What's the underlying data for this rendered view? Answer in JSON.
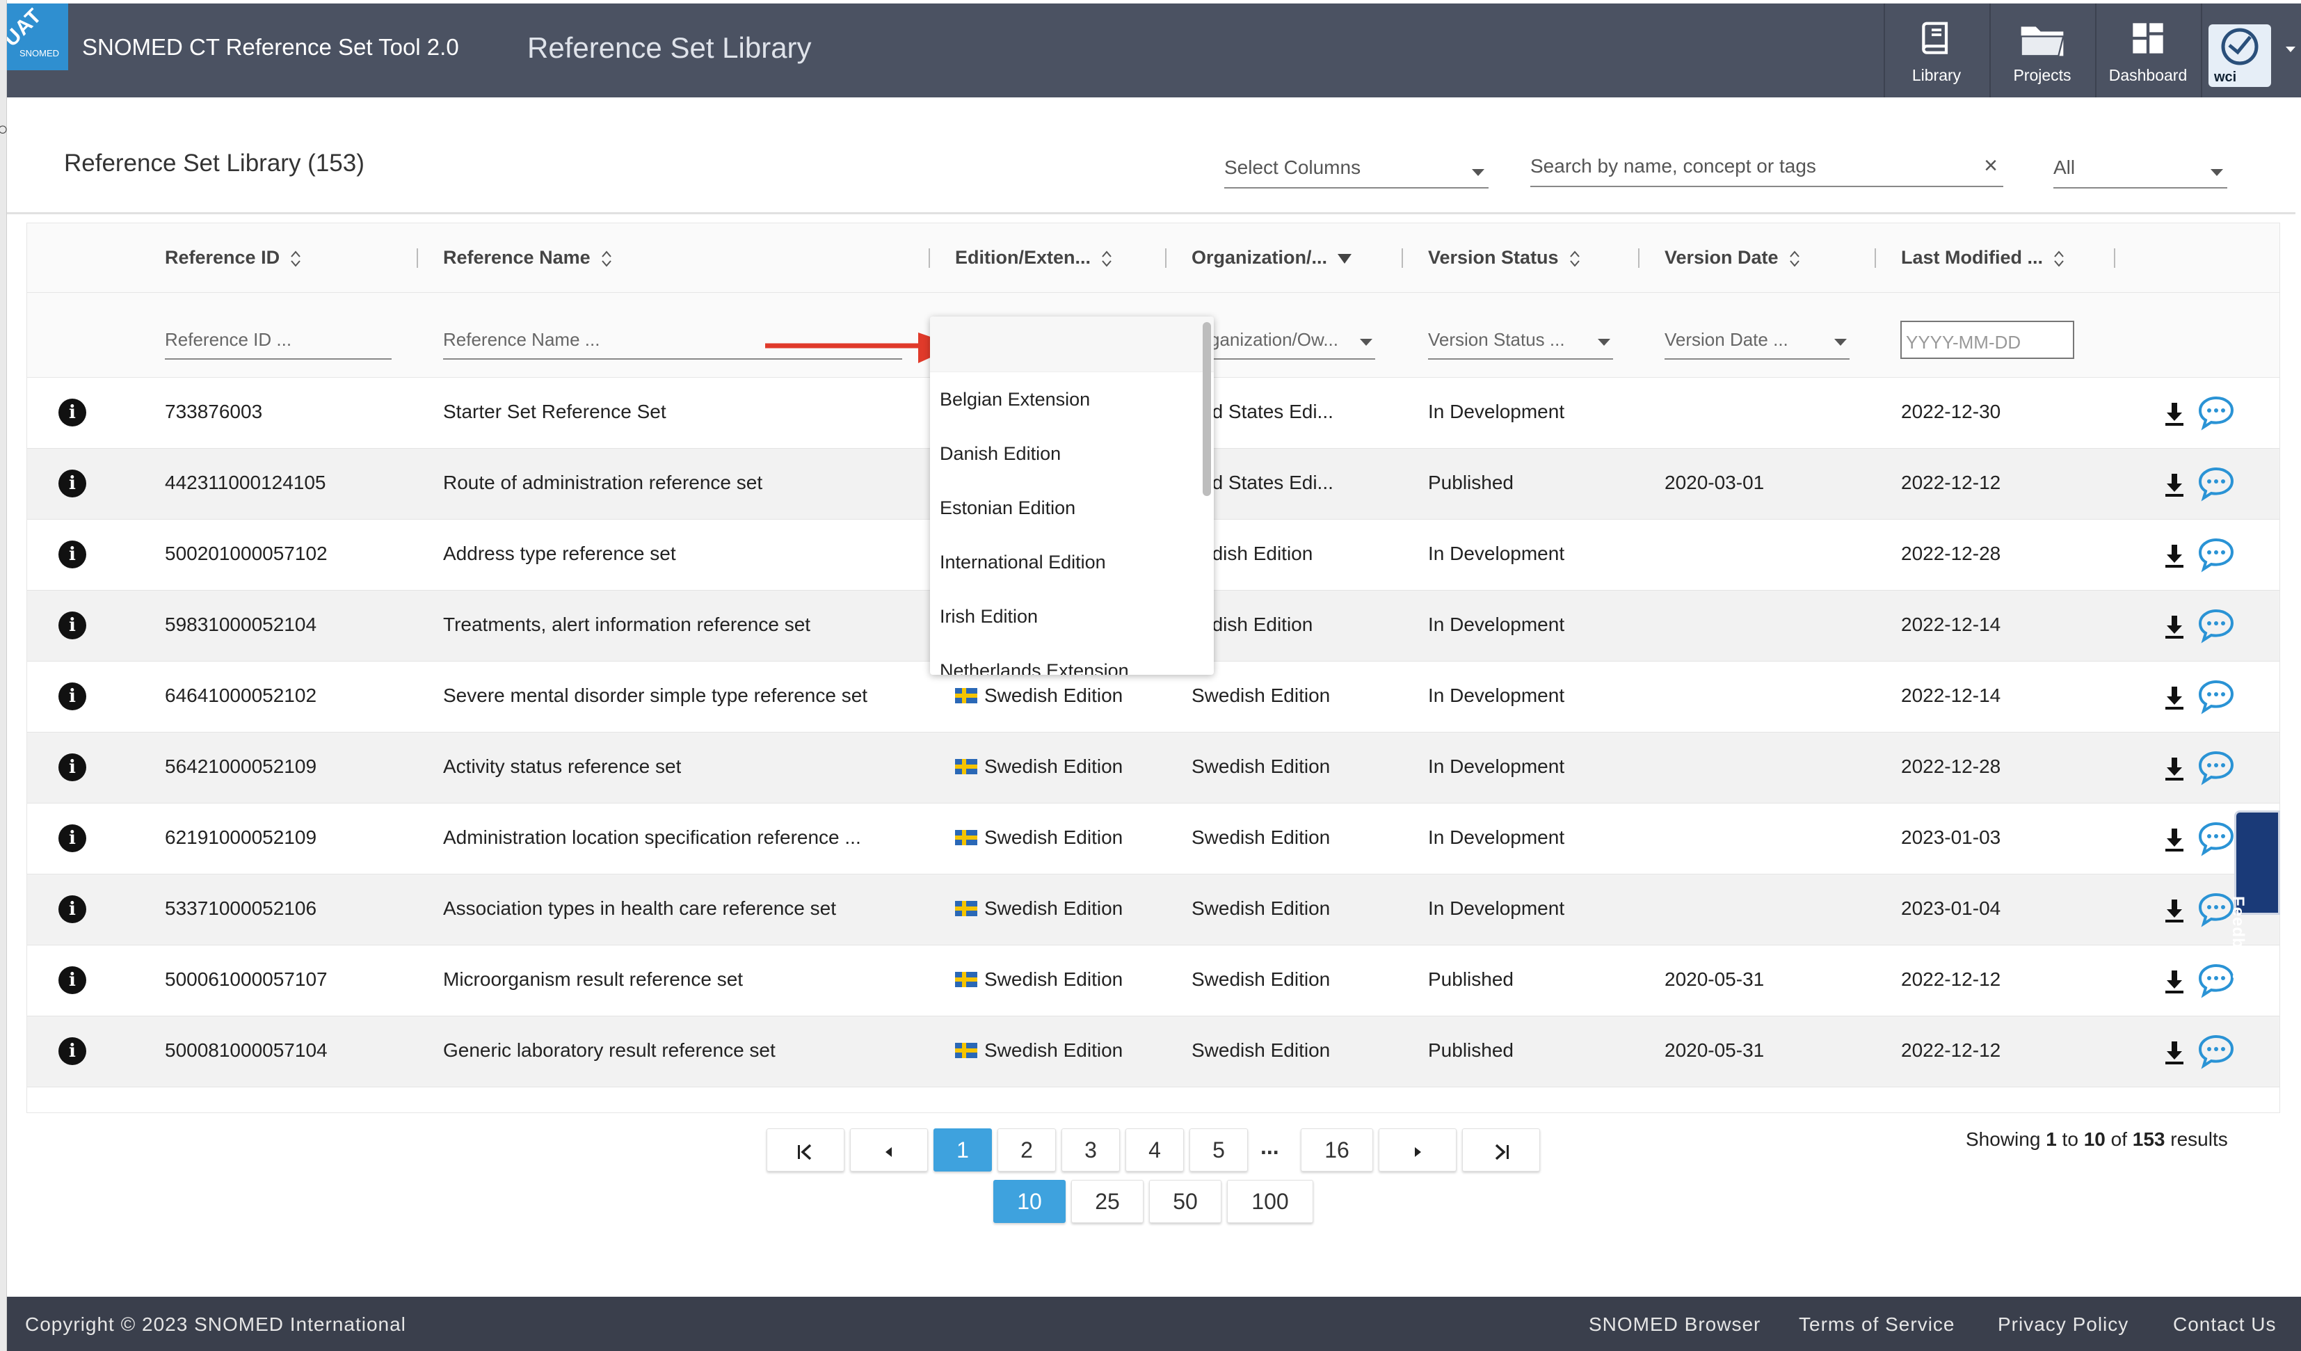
{
  "header": {
    "badge": "UAT",
    "logo_text": "SNOMED",
    "app_title": "SNOMED CT Reference Set Tool 2.0",
    "page_title": "Reference Set Library",
    "nav": [
      {
        "label": "Library",
        "icon": "library-book-icon"
      },
      {
        "label": "Projects",
        "icon": "folder-icon"
      },
      {
        "label": "Dashboard",
        "icon": "dashboard-grid-icon"
      }
    ],
    "avatar_text": "wci"
  },
  "library": {
    "title": "Reference Set Library (153)",
    "select_columns_placeholder": "Select Columns",
    "search_placeholder": "Search by name, concept or tags",
    "scope_value": "All"
  },
  "table": {
    "columns": [
      "Reference ID",
      "Reference Name",
      "Edition/Exten...",
      "Organization/...",
      "Version Status",
      "Version Date",
      "Last Modified ..."
    ],
    "filters": {
      "reference_id": "Reference ID ...",
      "reference_name": "Reference Name ...",
      "organization": "ganization/Ow...",
      "version_status": "Version Status ...",
      "version_date": "Version Date ...",
      "last_modified": "YYYY-MM-DD"
    },
    "rows": [
      {
        "id": "733876003",
        "name": "Starter Set Reference Set",
        "edition": "",
        "org": "ited States Edi...",
        "status": "In Development",
        "date": "",
        "modified": "2022-12-30"
      },
      {
        "id": "442311000124105",
        "name": "Route of administration reference set",
        "edition": "",
        "org": "ited States Edi...",
        "status": "Published",
        "date": "2020-03-01",
        "modified": "2022-12-12"
      },
      {
        "id": "500201000057102",
        "name": "Address type reference set",
        "edition": "",
        "org": "vedish Edition",
        "status": "In Development",
        "date": "",
        "modified": "2022-12-28"
      },
      {
        "id": "59831000052104",
        "name": "Treatments, alert information reference set",
        "edition": "",
        "org": "vedish Edition",
        "status": "In Development",
        "date": "",
        "modified": "2022-12-14"
      },
      {
        "id": "64641000052102",
        "name": "Severe mental disorder simple type reference set",
        "edition": "Swedish Edition",
        "org": "Swedish Edition",
        "status": "In Development",
        "date": "",
        "modified": "2022-12-14"
      },
      {
        "id": "56421000052109",
        "name": "Activity status reference set",
        "edition": "Swedish Edition",
        "org": "Swedish Edition",
        "status": "In Development",
        "date": "",
        "modified": "2022-12-28"
      },
      {
        "id": "62191000052109",
        "name": "Administration location specification reference ...",
        "edition": "Swedish Edition",
        "org": "Swedish Edition",
        "status": "In Development",
        "date": "",
        "modified": "2023-01-03"
      },
      {
        "id": "53371000052106",
        "name": "Association types in health care reference set",
        "edition": "Swedish Edition",
        "org": "Swedish Edition",
        "status": "In Development",
        "date": "",
        "modified": "2023-01-04"
      },
      {
        "id": "500061000057107",
        "name": "Microorganism result reference set",
        "edition": "Swedish Edition",
        "org": "Swedish Edition",
        "status": "Published",
        "date": "2020-05-31",
        "modified": "2022-12-12"
      },
      {
        "id": "500081000057104",
        "name": "Generic laboratory result reference set",
        "edition": "Swedish Edition",
        "org": "Swedish Edition",
        "status": "Published",
        "date": "2020-05-31",
        "modified": "2022-12-12"
      }
    ]
  },
  "edition_dropdown": {
    "options": [
      "Belgian Extension",
      "Danish Edition",
      "Estonian Edition",
      "International Edition",
      "Irish Edition",
      "Netherlands Extension"
    ]
  },
  "pagination": {
    "pages": [
      "1",
      "2",
      "3",
      "4",
      "5",
      "16"
    ],
    "ellipsis": "...",
    "page_sizes": [
      "10",
      "25",
      "50",
      "100"
    ],
    "showing": {
      "prefix": "Showing",
      "from": "1",
      "to_word": "to",
      "to": "10",
      "of_word": "of",
      "total": "153",
      "suffix": "results"
    }
  },
  "feedback_label": "Feedback",
  "footer": {
    "copyright": "Copyright © 2023 SNOMED International",
    "links": [
      "SNOMED Browser",
      "Terms of Service",
      "Privacy Policy",
      "Contact Us"
    ]
  },
  "colors": {
    "topbar": "#4b5262",
    "accent": "#3ea2de",
    "arrow": "#e03a2a",
    "feedback": "#1a3a78",
    "footer": "#3a3f4c"
  }
}
